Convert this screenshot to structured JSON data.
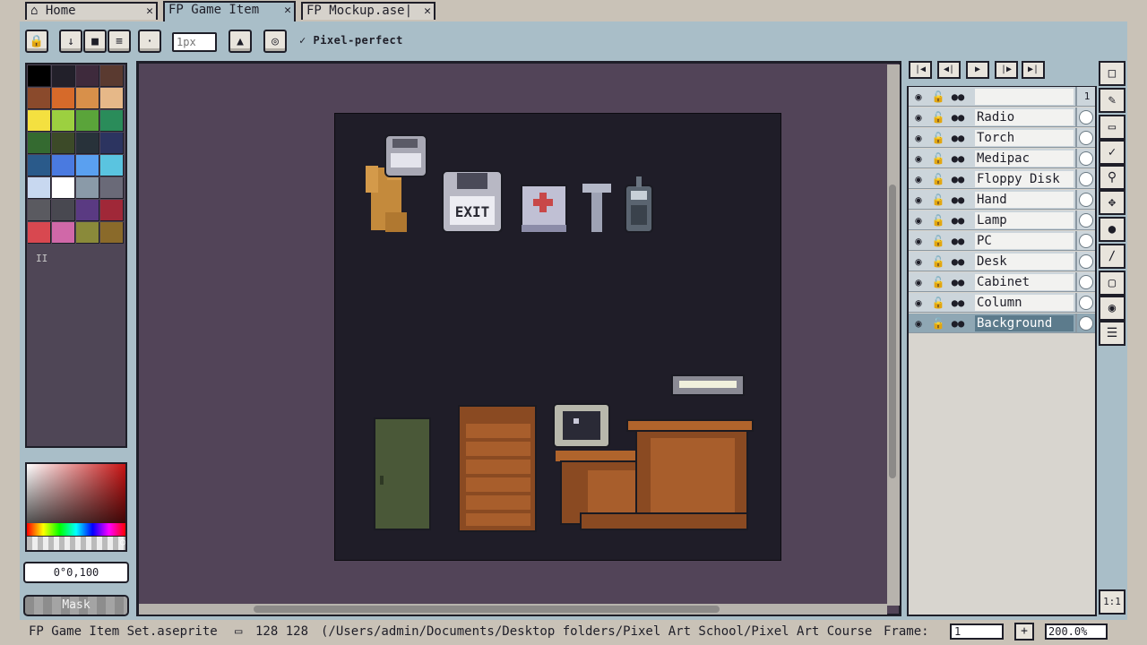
{
  "tabs": [
    {
      "label": "Home",
      "icon": "home-icon",
      "active": false
    },
    {
      "label": "FP Game Item",
      "active": true
    },
    {
      "label": "FP Mockup.ase|",
      "active": false
    }
  ],
  "toolbar": {
    "brush_size_placeholder": "1px",
    "pixel_perfect_label": "Pixel-perfect",
    "pixel_perfect_checked": true
  },
  "palette": [
    "#000000",
    "#22202a",
    "#3e2a3c",
    "#5a3a30",
    "#8a4a2c",
    "#d66a2a",
    "#d8904a",
    "#e6b888",
    "#f4e040",
    "#9cd040",
    "#5aa43a",
    "#2a8c5a",
    "#346a30",
    "#3c4a28",
    "#28323a",
    "#2c3460",
    "#2a5a8a",
    "#4a7ae0",
    "#5aa0f0",
    "#5ac4e0",
    "#c8d8f0",
    "#ffffff",
    "#8a9aa8",
    "#6a6a78",
    "#5a5a60",
    "#484850",
    "#5a3a82",
    "#a02838",
    "#d84850",
    "#d068a8",
    "#8a8a3a",
    "#8a6a2a"
  ],
  "color_picker": {
    "value": "0°0,100",
    "mask_label": "Mask"
  },
  "frame_controls": [
    "first-frame-icon",
    "prev-frame-icon",
    "play-icon",
    "next-frame-icon",
    "last-frame-icon"
  ],
  "timeline": {
    "frame_number": "1",
    "layers": [
      {
        "name": "",
        "selected": false
      },
      {
        "name": "Radio",
        "selected": false
      },
      {
        "name": "Torch",
        "selected": false
      },
      {
        "name": "Medipac",
        "selected": false
      },
      {
        "name": "Floppy Disk",
        "selected": false
      },
      {
        "name": "Hand",
        "selected": false
      },
      {
        "name": "Lamp",
        "selected": false
      },
      {
        "name": "PC",
        "selected": false
      },
      {
        "name": "Desk",
        "selected": false
      },
      {
        "name": "Cabinet",
        "selected": false
      },
      {
        "name": "Column",
        "selected": false
      },
      {
        "name": "Background",
        "selected": true
      }
    ]
  },
  "tools": [
    "marquee-icon",
    "pencil-icon",
    "eraser-icon",
    "eyedropper-icon",
    "zoom-icon",
    "move-icon",
    "fill-icon",
    "line-icon",
    "rectangle-icon",
    "contour-icon",
    "blur-icon"
  ],
  "zoom_fit_label": "1:1",
  "canvas": {
    "exit_label": "EXIT"
  },
  "status": {
    "filename": "FP Game Item Set.aseprite",
    "size": "128 128",
    "path": "(/Users/admin/Documents/Desktop folders/Pixel Art School/Pixel Art Course",
    "frame_label": "Frame:",
    "frame_value": "1",
    "add_frame_label": "+",
    "zoom_value": "200.0%"
  }
}
